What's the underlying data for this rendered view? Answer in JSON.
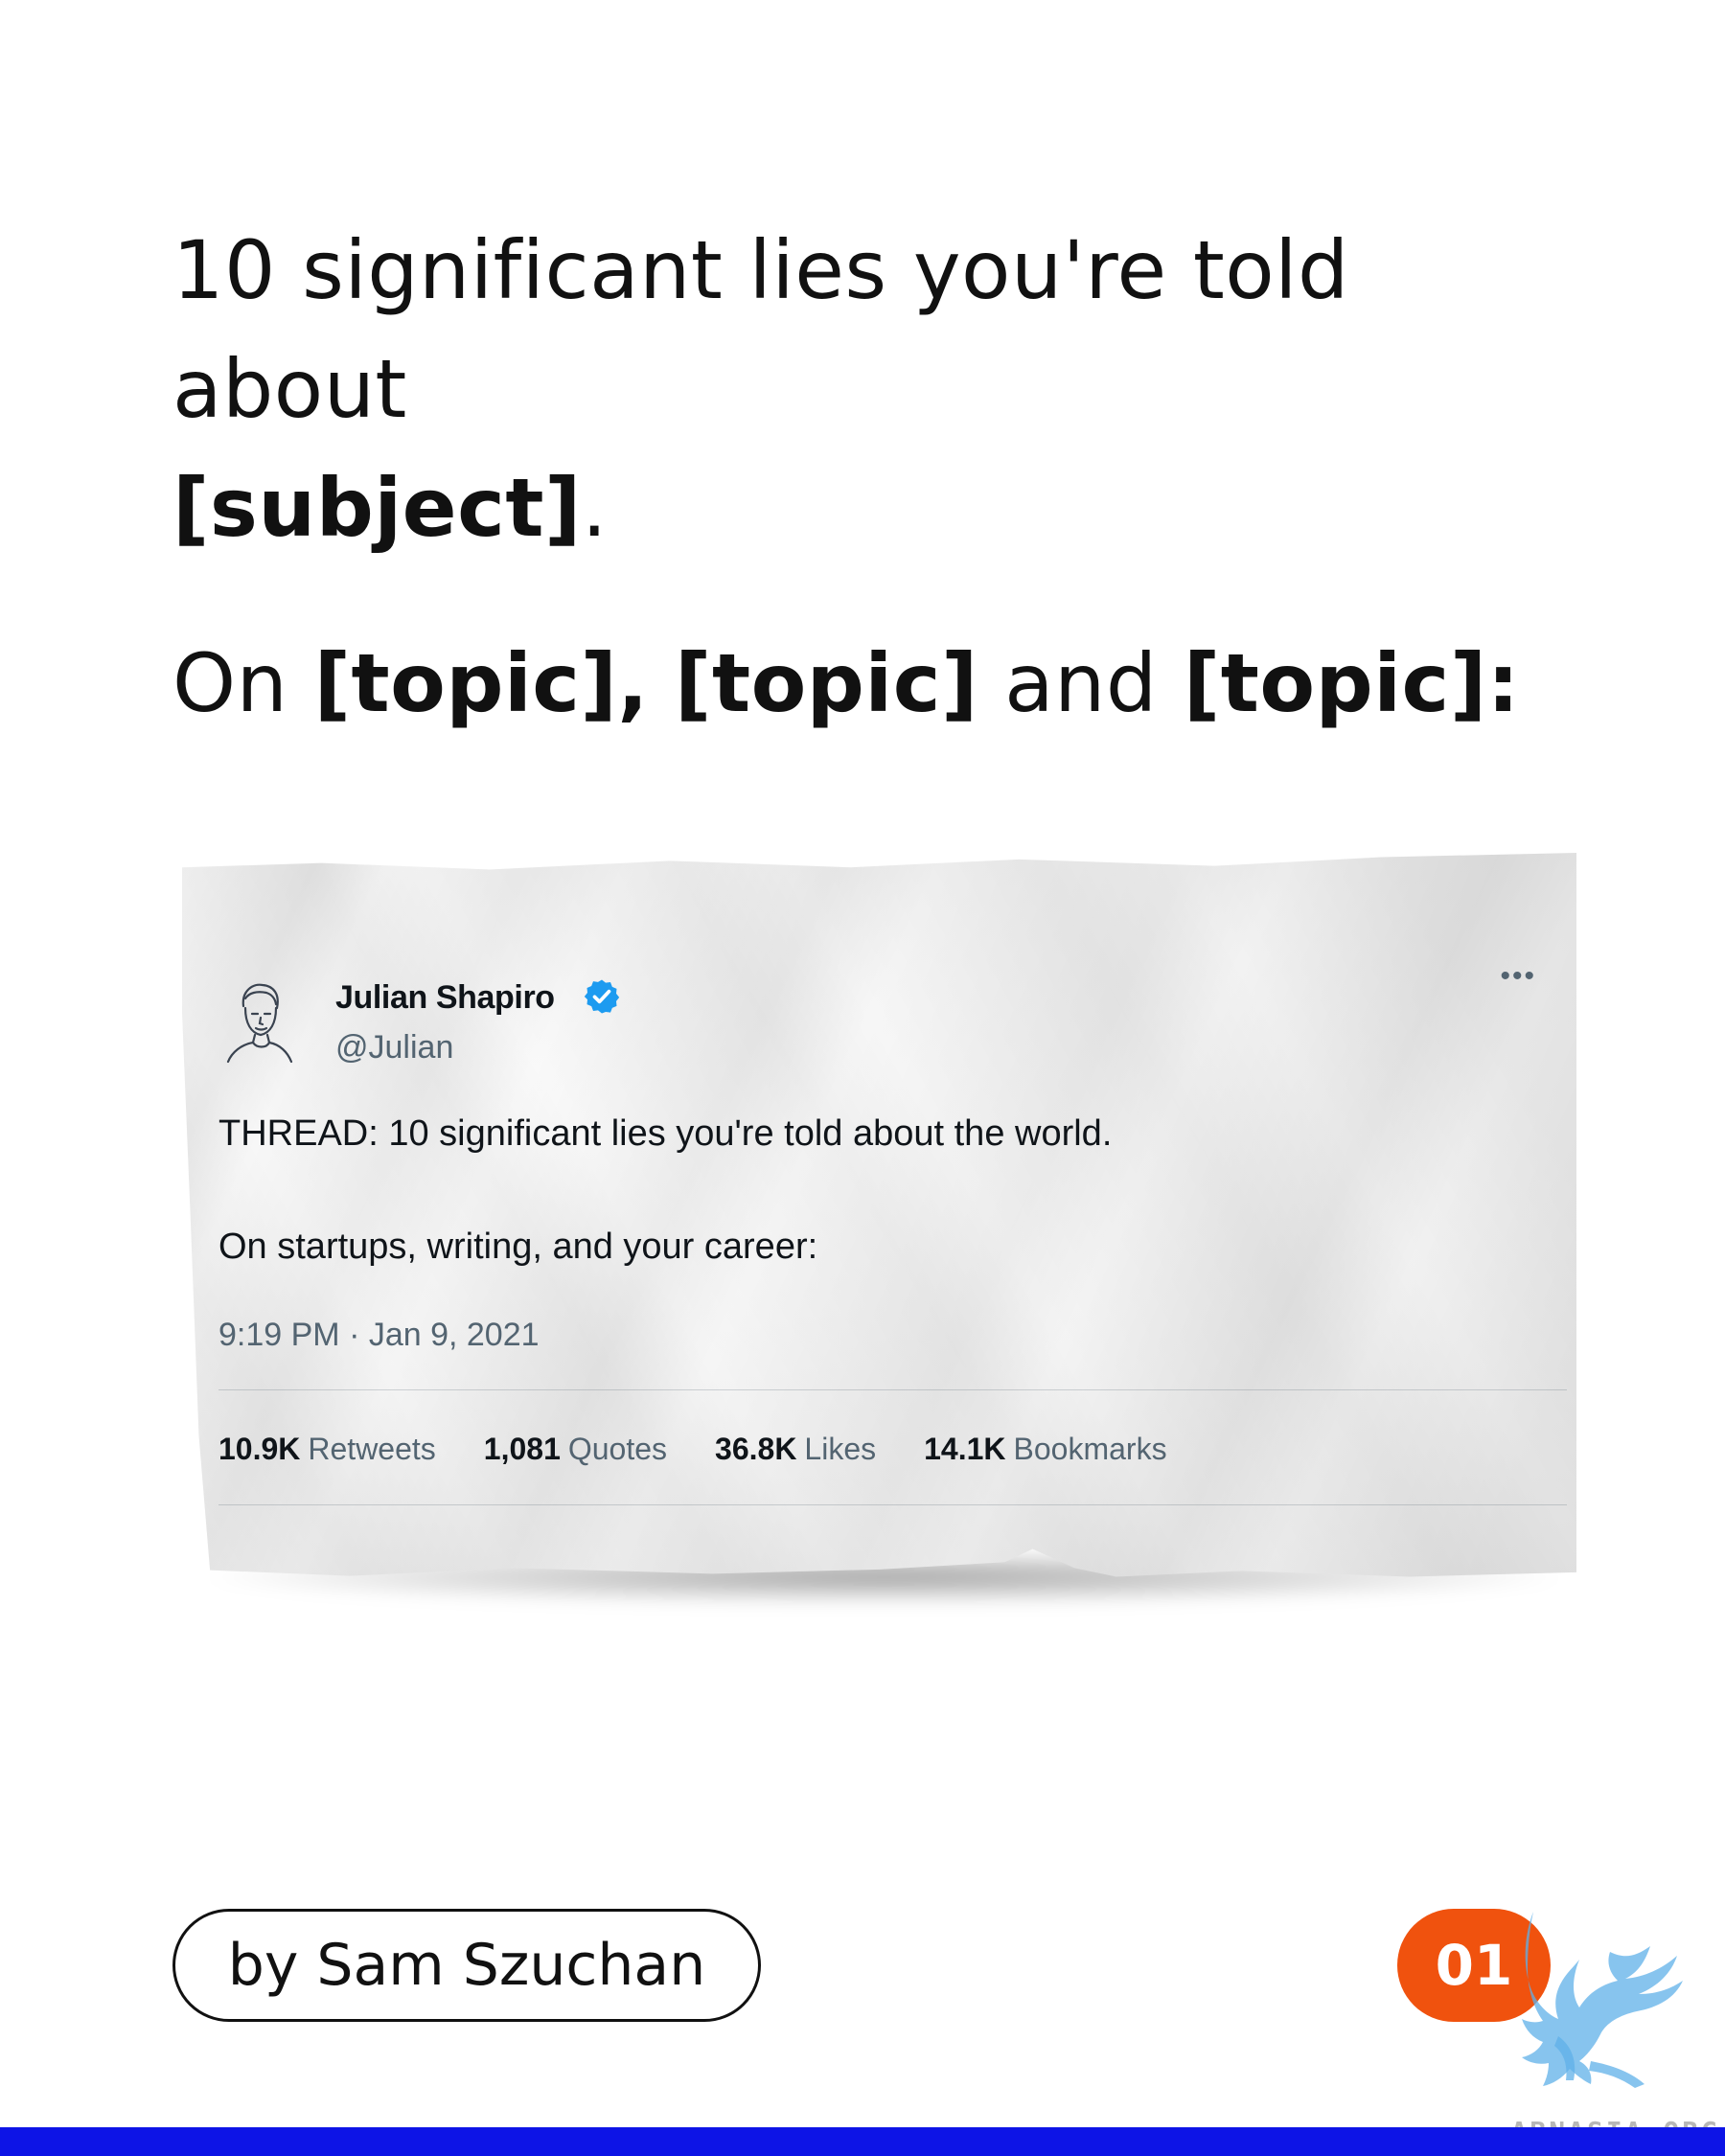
{
  "headline": {
    "line1_prefix": "10 significant lies you're told about",
    "line1_subject": "[subject]",
    "line1_period": ".",
    "line2_on": "On",
    "line2_topic1": "[topic],",
    "line2_topic2": "[topic]",
    "line2_and": "and",
    "line2_topic3": "[topic]:"
  },
  "tweet": {
    "name": "Julian Shapiro",
    "handle": "@Julian",
    "more_icon": "more-options-icon",
    "line1": "THREAD: 10 significant lies you're told about the world.",
    "line2": "On startups, writing, and your career:",
    "timestamp": "9:19 PM · Jan 9, 2021",
    "stats": [
      {
        "value": "10.9K",
        "label": "Retweets"
      },
      {
        "value": "1,081",
        "label": "Quotes"
      },
      {
        "value": "36.8K",
        "label": "Likes"
      },
      {
        "value": "14.1K",
        "label": "Bookmarks"
      }
    ]
  },
  "byline": "by Sam Szuchan",
  "page_number": "01",
  "watermark": "ABNASIA.ORG",
  "colors": {
    "accent_orange": "#f0520e",
    "bottom_bar": "#0d14e6",
    "verified_blue": "#1d9bf0"
  }
}
